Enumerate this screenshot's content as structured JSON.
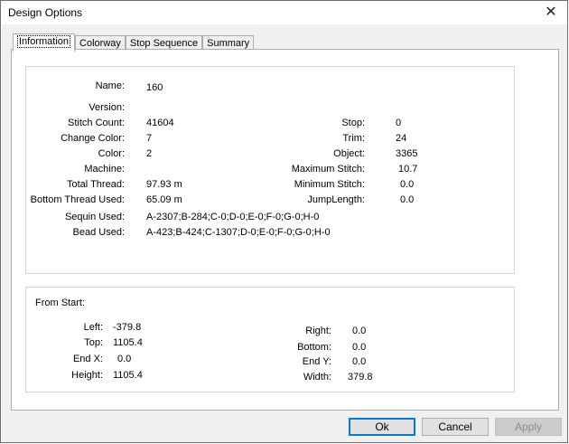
{
  "window": {
    "title": "Design Options",
    "close_symbol": "✕"
  },
  "tabs": [
    {
      "label": "Information",
      "active": true
    },
    {
      "label": "Colorway",
      "active": false
    },
    {
      "label": "Stop Sequence",
      "active": false
    },
    {
      "label": "Summary",
      "active": false
    }
  ],
  "info": {
    "name": {
      "label": "Name:",
      "value": "160"
    },
    "version": {
      "label": "Version:",
      "value": ""
    },
    "stitch_count": {
      "label": "Stitch Count:",
      "value": "41604"
    },
    "change_color": {
      "label": "Change Color:",
      "value": "7"
    },
    "color": {
      "label": "Color:",
      "value": "2"
    },
    "machine": {
      "label": "Machine:",
      "value": ""
    },
    "total_thread": {
      "label": "Total Thread:",
      "value": "97.93 m"
    },
    "bottom_thread": {
      "label": "Bottom Thread Used:",
      "value": "65.09 m"
    },
    "sequin": {
      "label": "Sequin Used:",
      "value": "A-2307;B-284;C-0;D-0;E-0;F-0;G-0;H-0"
    },
    "bead": {
      "label": "Bead Used:",
      "value": "A-423;B-424;C-1307;D-0;E-0;F-0;G-0;H-0"
    },
    "stop": {
      "label": "Stop:",
      "value": "0"
    },
    "trim": {
      "label": "Trim:",
      "value": "24"
    },
    "object": {
      "label": "Object:",
      "value": "3365"
    },
    "max_stitch": {
      "label": "Maximum Stitch:",
      "value": "10.7"
    },
    "min_stitch": {
      "label": "Minimum Stitch:",
      "value": "0.0"
    },
    "jump_length": {
      "label": "JumpLength:",
      "value": "0.0"
    }
  },
  "from_start": {
    "heading": "From Start:",
    "left": {
      "label": "Left:",
      "value": "-379.8"
    },
    "top": {
      "label": "Top:",
      "value": "1105.4"
    },
    "end_x": {
      "label": "End X:",
      "value": "0.0"
    },
    "height": {
      "label": "Height:",
      "value": "1105.4"
    },
    "right": {
      "label": "Right:",
      "value": "0.0"
    },
    "bottom": {
      "label": "Bottom:",
      "value": "0.0"
    },
    "end_y": {
      "label": "End Y:",
      "value": "0.0"
    },
    "width": {
      "label": "Width:",
      "value": "379.8"
    }
  },
  "buttons": {
    "ok": "Ok",
    "cancel": "Cancel",
    "apply": "Apply"
  }
}
